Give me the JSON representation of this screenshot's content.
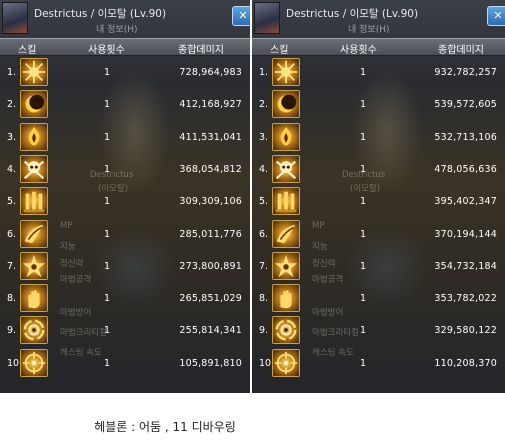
{
  "panels": [
    {
      "title": "Destrictus / 이모탈 (Lv.90)",
      "subtitle": "내 정보(H)",
      "columns": {
        "skill": "스킬",
        "uses": "사용횟수",
        "damage": "종합데미지"
      },
      "rows": [
        {
          "num": "1.",
          "uses": "1",
          "damage": "728,964,983",
          "icon": "burst-icon"
        },
        {
          "num": "2.",
          "uses": "1",
          "damage": "412,168,927",
          "icon": "dark-moon-icon"
        },
        {
          "num": "3.",
          "uses": "1",
          "damage": "411,531,041",
          "icon": "fire-aura-icon"
        },
        {
          "num": "4.",
          "uses": "1",
          "damage": "368,054,812",
          "icon": "skull-crossbones-icon"
        },
        {
          "num": "5.",
          "uses": "1",
          "damage": "309,309,106",
          "icon": "pillars-icon"
        },
        {
          "num": "6.",
          "uses": "1",
          "damage": "285,011,776",
          "icon": "wing-slash-icon"
        },
        {
          "num": "7.",
          "uses": "1",
          "damage": "273,800,891",
          "icon": "star-burst-icon"
        },
        {
          "num": "8.",
          "uses": "1",
          "damage": "265,851,029",
          "icon": "spirit-hand-icon"
        },
        {
          "num": "9.",
          "uses": "1",
          "damage": "255,814,341",
          "icon": "vortex-icon"
        },
        {
          "num": "10.",
          "uses": "1",
          "damage": "105,891,810",
          "icon": "crosshair-icon"
        }
      ]
    },
    {
      "title": "Destrictus / 이모탈 (Lv.90)",
      "subtitle": "내 정보(H)",
      "columns": {
        "skill": "스킬",
        "uses": "사용횟수",
        "damage": "종합데미지"
      },
      "rows": [
        {
          "num": "1.",
          "uses": "1",
          "damage": "932,782,257",
          "icon": "burst-icon"
        },
        {
          "num": "2.",
          "uses": "1",
          "damage": "539,572,605",
          "icon": "dark-moon-icon"
        },
        {
          "num": "3.",
          "uses": "1",
          "damage": "532,713,106",
          "icon": "fire-aura-icon"
        },
        {
          "num": "4.",
          "uses": "1",
          "damage": "478,056,636",
          "icon": "skull-crossbones-icon"
        },
        {
          "num": "5.",
          "uses": "1",
          "damage": "395,402,347",
          "icon": "pillars-icon"
        },
        {
          "num": "6.",
          "uses": "1",
          "damage": "370,194,144",
          "icon": "wing-slash-icon"
        },
        {
          "num": "7.",
          "uses": "1",
          "damage": "354,732,184",
          "icon": "star-burst-icon"
        },
        {
          "num": "8.",
          "uses": "1",
          "damage": "353,782,022",
          "icon": "spirit-hand-icon"
        },
        {
          "num": "9.",
          "uses": "1",
          "damage": "329,580,122",
          "icon": "vortex-icon"
        },
        {
          "num": "10.",
          "uses": "1",
          "damage": "110,208,370",
          "icon": "crosshair-icon"
        }
      ]
    }
  ],
  "background_text": {
    "name": "Destrictus",
    "class": "(이모탈)",
    "stats": [
      "MP",
      "지능",
      "정신력",
      "마법공격",
      "마법방어",
      "마법크리티컬",
      "캐스팅 속도"
    ]
  },
  "caption": "헤블론 : 어둠 , 11 디바우링"
}
